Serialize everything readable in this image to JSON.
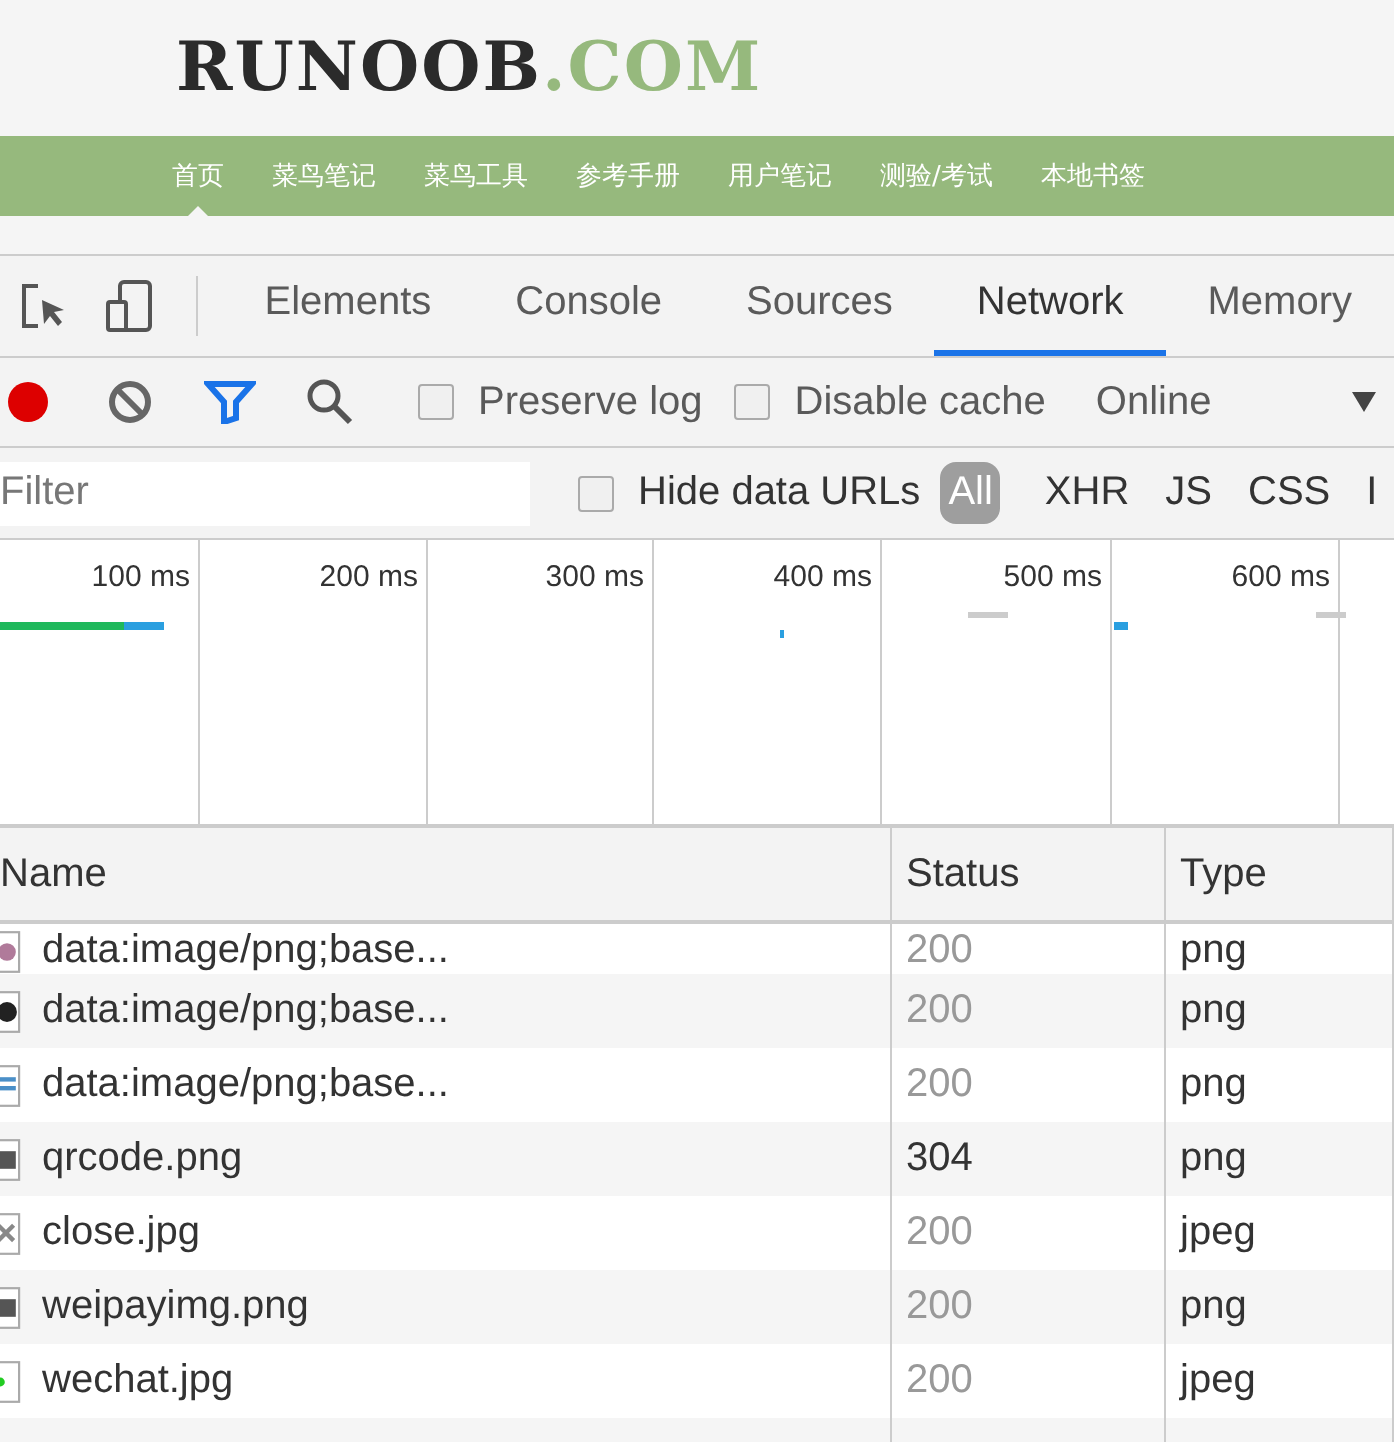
{
  "site": {
    "logo_main": "RUNOOB",
    "logo_suffix": ".COM",
    "nav": [
      {
        "label": "首页",
        "selected": true
      },
      {
        "label": "菜鸟笔记",
        "selected": false
      },
      {
        "label": "菜鸟工具",
        "selected": false
      },
      {
        "label": "参考手册",
        "selected": false
      },
      {
        "label": "用户笔记",
        "selected": false
      },
      {
        "label": "测验/考试",
        "selected": false
      },
      {
        "label": "本地书签",
        "selected": false
      }
    ]
  },
  "devtools": {
    "tabs": [
      {
        "label": "Elements",
        "selected": false
      },
      {
        "label": "Console",
        "selected": false
      },
      {
        "label": "Sources",
        "selected": false
      },
      {
        "label": "Network",
        "selected": true
      },
      {
        "label": "Memory",
        "selected": false
      }
    ],
    "toolbar": {
      "recording": true,
      "filter_on": true,
      "preserve_log": {
        "label": "Preserve log",
        "checked": false
      },
      "disable_cache": {
        "label": "Disable cache",
        "checked": false
      },
      "throttling": "Online"
    },
    "filter": {
      "placeholder": "Filter",
      "hide_data_urls": {
        "label": "Hide data URLs",
        "checked": false
      },
      "types": [
        {
          "label": "All",
          "selected": true
        },
        {
          "label": "XHR",
          "selected": false
        },
        {
          "label": "JS",
          "selected": false
        },
        {
          "label": "CSS",
          "selected": false
        },
        {
          "label": "I",
          "selected": false
        }
      ]
    },
    "timeline": {
      "ticks": [
        "100 ms",
        "200 ms",
        "300 ms",
        "400 ms",
        "500 ms",
        "600 ms"
      ]
    },
    "table": {
      "columns": [
        "Name",
        "Status",
        "Type"
      ],
      "rows": [
        {
          "name": "data:image/png;base...",
          "status": "200",
          "type": "png",
          "cached": true
        },
        {
          "name": "data:image/png;base...",
          "status": "200",
          "type": "png",
          "cached": true
        },
        {
          "name": "data:image/png;base...",
          "status": "200",
          "type": "png",
          "cached": true
        },
        {
          "name": "qrcode.png",
          "status": "304",
          "type": "png",
          "cached": false
        },
        {
          "name": "close.jpg",
          "status": "200",
          "type": "jpeg",
          "cached": true
        },
        {
          "name": "weipayimg.png",
          "status": "200",
          "type": "png",
          "cached": true
        },
        {
          "name": "wechat.jpg",
          "status": "200",
          "type": "jpeg",
          "cached": true
        }
      ]
    }
  }
}
